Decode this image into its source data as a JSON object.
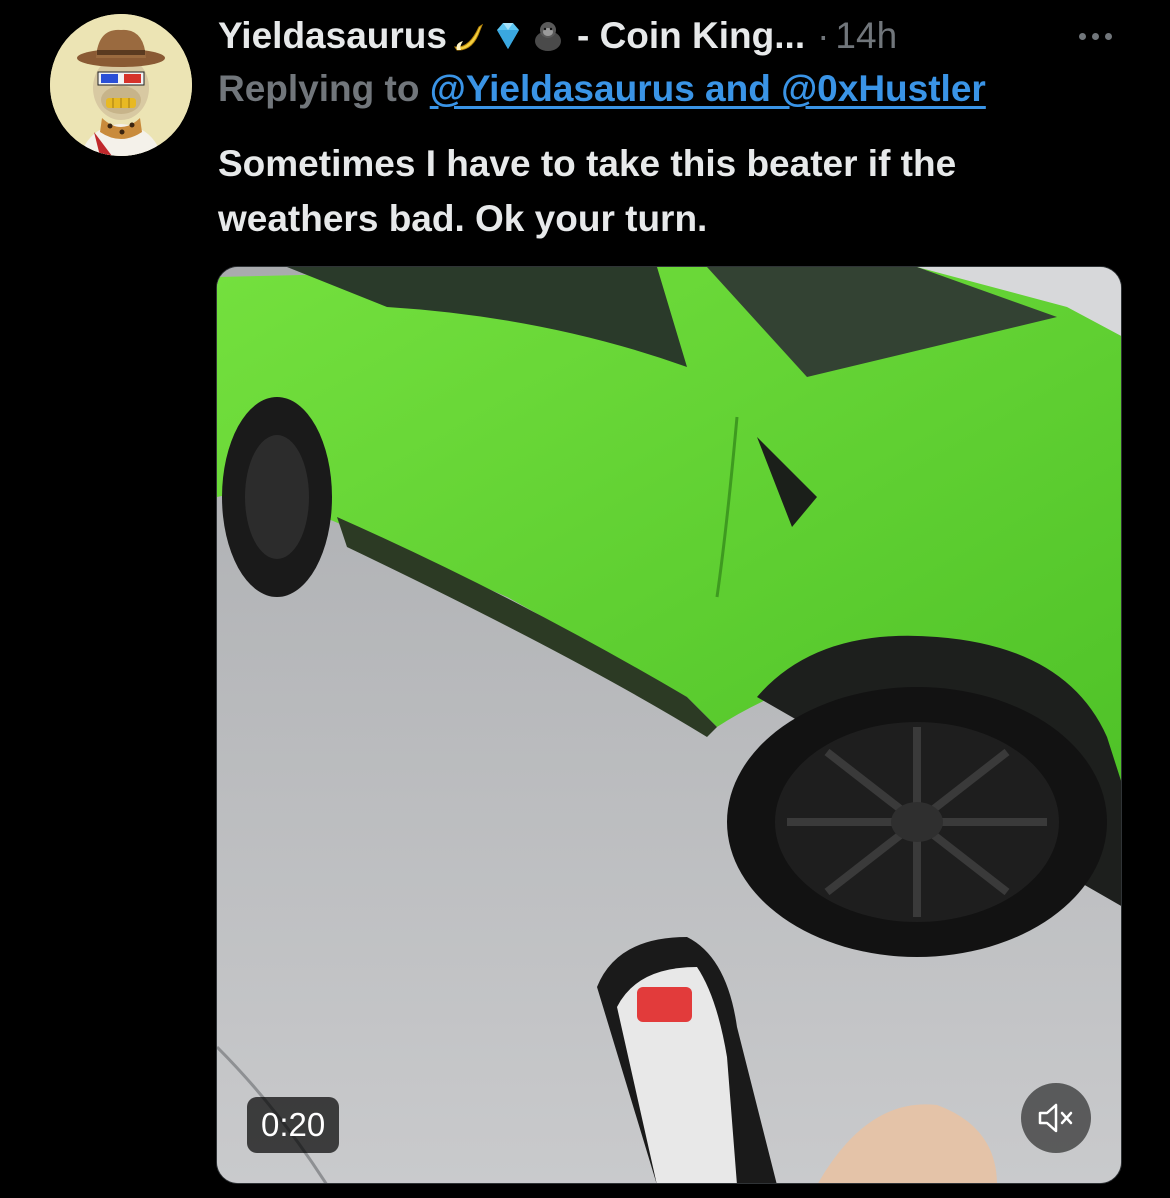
{
  "tweet": {
    "author": {
      "display_name": "Yieldasaurus",
      "name_emojis": [
        "banana-icon",
        "gem-icon",
        "gorilla-icon"
      ],
      "name_suffix": "- Coin King...",
      "separator": "·",
      "timestamp": "14h"
    },
    "reply": {
      "prefix": "Replying to",
      "targets": "@Yieldasaurus and @0xHustler"
    },
    "text_line1": "Sometimes I have to take this beater if the",
    "text_line2": "weathers bad. Ok your turn.",
    "media": {
      "type": "video",
      "duration": "0:20",
      "muted": true
    }
  },
  "colors": {
    "background": "#000000",
    "text_primary": "#e7e9ea",
    "text_secondary": "#71767b",
    "link": "#3a94e6",
    "car_green": "#5ed531"
  }
}
